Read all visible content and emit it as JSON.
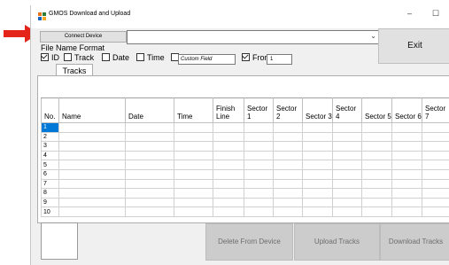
{
  "window": {
    "title": "GMOS Download and Upload",
    "minimize_glyph": "–",
    "maximize_glyph": "☐"
  },
  "toolbar": {
    "connect_label": "Connect Device",
    "combo_value": "",
    "exit_label": "Exit"
  },
  "format": {
    "label": "File Name Format",
    "options": [
      {
        "label": "ID",
        "checked": true
      },
      {
        "label": "Track",
        "checked": false
      },
      {
        "label": "Date",
        "checked": false
      },
      {
        "label": "Time",
        "checked": false
      }
    ],
    "custom_field": {
      "label": "Custom Field",
      "checked": false
    },
    "from": {
      "label": "From",
      "checked": true,
      "value": "1"
    }
  },
  "tabs": [
    {
      "label": "Tracks"
    }
  ],
  "table": {
    "headers": [
      "No.",
      "Name",
      "Date",
      "Time",
      "Finish Line",
      "Sector 1",
      "Sector 2",
      "Sector 3",
      "Sector 4",
      "Sector 5",
      "Sector 6",
      "Sector 7"
    ],
    "rows": [
      "1",
      "2",
      "3",
      "4",
      "5",
      "6",
      "7",
      "8",
      "9",
      "10"
    ],
    "selected_row": 0
  },
  "actions": {
    "delete_label": "Delete From Device",
    "upload_label": "Upload Tracks",
    "download_label": "Download Tracks"
  },
  "colors": {
    "arrow": "#e4231b",
    "selection": "#0078d7"
  },
  "icons": {
    "app": "app-icon",
    "arrow": "red-arrow-icon"
  }
}
